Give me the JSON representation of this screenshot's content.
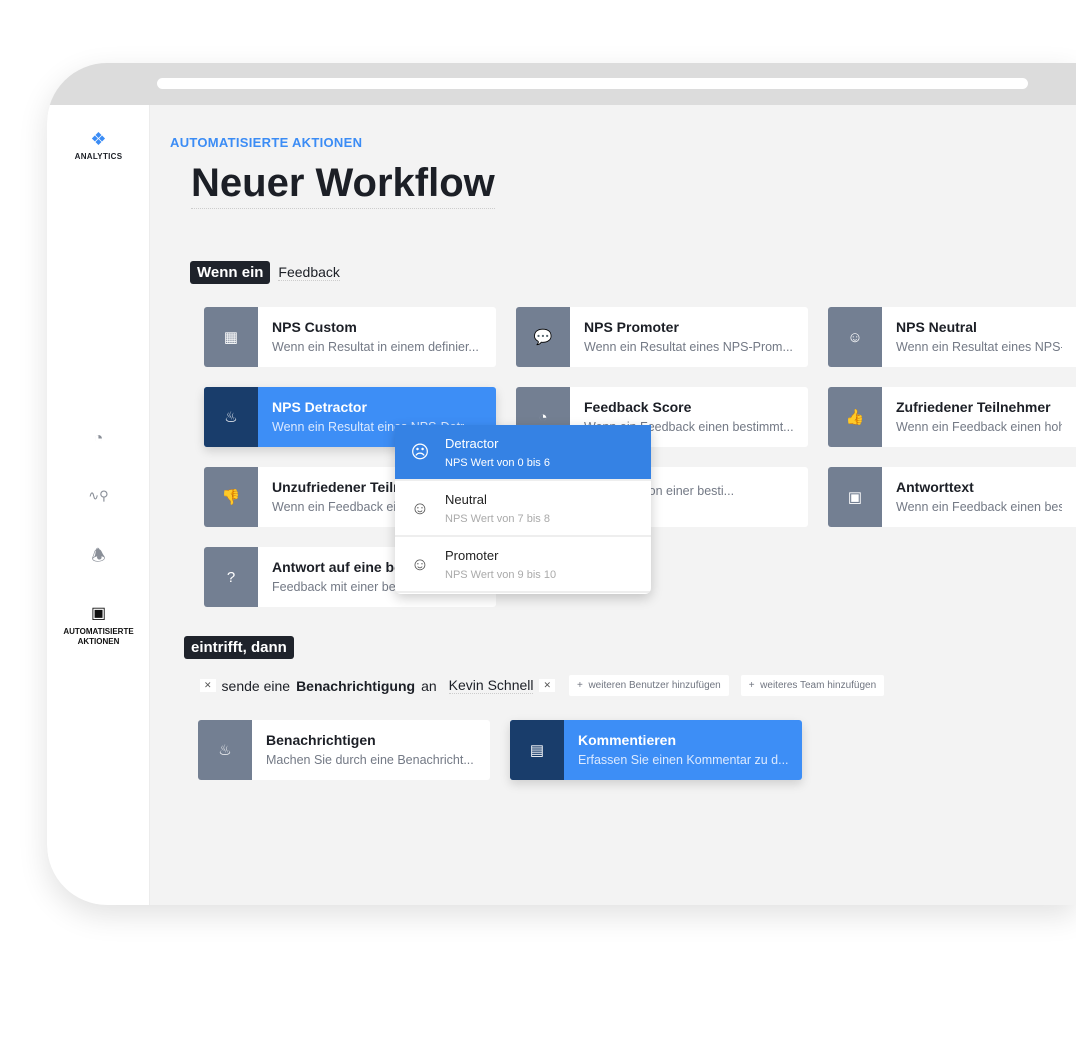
{
  "app": {
    "logo_label": "ANALYTICS",
    "brand_color": "#3b8cf5"
  },
  "sidebar": {
    "items": [
      {
        "icon": "gauge-icon",
        "label": ""
      },
      {
        "icon": "pulse-search-icon",
        "label": ""
      },
      {
        "icon": "bell-icon",
        "label": ""
      },
      {
        "icon": "robot-icon",
        "label": "AUTOMATISIERTE AKTIONEN",
        "active": true
      }
    ]
  },
  "header": {
    "breadcrumb": "AUTOMATISIERTE AKTIONEN",
    "title": "Neuer Workflow"
  },
  "trigger": {
    "tag": "Wenn ein",
    "subject": "Feedback"
  },
  "triggers": [
    {
      "title": "NPS Custom",
      "desc": "Wenn ein Resultat in einem definier...",
      "icon": "abacus-icon"
    },
    {
      "title": "NPS Promoter",
      "desc": "Wenn ein Resultat eines NPS-Prom...",
      "icon": "chat-bubbles-icon"
    },
    {
      "title": "NPS Neutral",
      "desc": "Wenn ein Resultat eines NPS-Neutral",
      "icon": "neutral-face-icon"
    },
    {
      "title": "NPS Detractor",
      "desc": "Wenn ein Resultat eines NPS-Detr...",
      "icon": "fire-icon",
      "selected": true
    },
    {
      "title": "Feedback Score",
      "desc": "Wenn ein Feedback einen bestimmt...",
      "icon": "gauge-icon"
    },
    {
      "title": "Zufriedener Teilnehmer",
      "desc": "Wenn ein Feedback einen hohen",
      "icon": "thumbs-up-icon"
    },
    {
      "title": "Unzufriedener Teilnehmer",
      "desc": "Wenn ein Feedback einen",
      "icon": "thumbs-down-icon"
    },
    {
      "title": "",
      "desc": "Feedback von einer besti...",
      "icon": ""
    },
    {
      "title": "Antworttext",
      "desc": "Wenn ein Feedback einen bestimmten",
      "icon": "text-box-icon"
    },
    {
      "title": "Antwort auf eine bestimmte",
      "desc": "Feedback mit einer bestimmten",
      "icon": "question-icon"
    }
  ],
  "dropdown": [
    {
      "label": "Detractor",
      "sub": "NPS Wert von 0 bis 6",
      "icon": "sad-face-icon",
      "active": true
    },
    {
      "label": "Neutral",
      "sub": "NPS Wert von 7 bis 8",
      "icon": "neutral-face-icon"
    },
    {
      "label": "Promoter",
      "sub": "NPS Wert von 9 bis 10",
      "icon": "smile-face-icon"
    }
  ],
  "action": {
    "tag": "eintrifft, dann",
    "pre": "sende eine",
    "bold": "Benachrichtigung",
    "post": "an",
    "user": "Kevin Schnell",
    "add_user": "weiteren Benutzer hinzufügen",
    "add_team": "weiteres Team hinzufügen"
  },
  "actions": [
    {
      "title": "Benachrichtigen",
      "desc": "Machen Sie durch eine Benachricht...",
      "icon": "bell-icon"
    },
    {
      "title": "Kommentieren",
      "desc": "Erfassen Sie einen Kommentar zu d...",
      "icon": "comment-icon",
      "selected": true
    }
  ]
}
